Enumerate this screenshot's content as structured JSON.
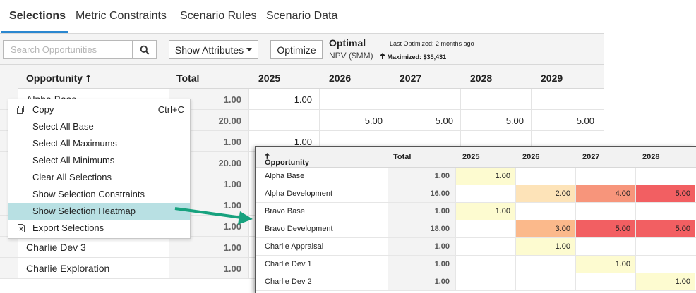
{
  "tabs": [
    "Selections",
    "Metric Constraints",
    "Scenario Rules",
    "Scenario Data"
  ],
  "toolbar": {
    "search_placeholder": "Search Opportunities",
    "show_attributes": "Show Attributes",
    "optimize": "Optimize",
    "status": "Optimal",
    "last_optimized_label": "Last Optimized:",
    "last_optimized_value": "2 months ago",
    "npv_label": "NPV ($MM)",
    "maximized_label": "Maximized:",
    "maximized_value": "$35,431"
  },
  "grid": {
    "headers": {
      "opportunity": "Opportunity",
      "total": "Total",
      "years": [
        "2025",
        "2026",
        "2027",
        "2028",
        "2029"
      ]
    },
    "rows": [
      {
        "name": "Alpha Base",
        "total": "1.00",
        "cells": [
          "1.00",
          "",
          "",
          "",
          ""
        ]
      },
      {
        "name": "",
        "total": "20.00",
        "cells": [
          "",
          "5.00",
          "5.00",
          "5.00",
          "5.00"
        ]
      },
      {
        "name": "",
        "total": "1.00",
        "cells": [
          "1.00",
          "",
          "",
          "",
          ""
        ]
      },
      {
        "name": "",
        "total": "20.00",
        "cells": [
          "",
          "",
          "",
          "",
          ""
        ]
      },
      {
        "name": "",
        "total": "1.00",
        "cells": [
          "",
          "",
          "",
          "",
          ""
        ]
      },
      {
        "name": "",
        "total": "1.00",
        "cells": [
          "",
          "",
          "",
          "",
          ""
        ]
      },
      {
        "name": "",
        "total": "1.00",
        "cells": [
          "",
          "",
          "",
          "",
          ""
        ]
      },
      {
        "name": "Charlie Dev 3",
        "total": "1.00",
        "cells": [
          "",
          "",
          "",
          "",
          ""
        ]
      },
      {
        "name": "Charlie Exploration",
        "total": "1.00",
        "cells": [
          "",
          "",
          "",
          "",
          ""
        ]
      }
    ]
  },
  "context_menu": {
    "items": [
      {
        "label": "Copy",
        "shortcut": "Ctrl+C",
        "icon": "copy-icon"
      },
      {
        "label": "Select All Base",
        "shortcut": ""
      },
      {
        "label": "Select All Maximums",
        "shortcut": ""
      },
      {
        "label": "Select All Minimums",
        "shortcut": ""
      },
      {
        "label": "Clear All Selections",
        "shortcut": ""
      },
      {
        "label": "Show Selection Constraints",
        "shortcut": ""
      },
      {
        "label": "Show Selection Heatmap",
        "shortcut": "",
        "highlighted": true
      },
      {
        "label": "Export Selections",
        "shortcut": "",
        "icon": "excel-icon"
      }
    ]
  },
  "heatmap": {
    "headers": {
      "opportunity": "Opportunity",
      "total": "Total",
      "years": [
        "2025",
        "2026",
        "2027",
        "2028"
      ]
    },
    "rows": [
      {
        "name": "Alpha Base",
        "total": "1.00",
        "cells": [
          "1.00",
          "",
          "",
          ""
        ]
      },
      {
        "name": "Alpha Development",
        "total": "16.00",
        "cells": [
          "",
          "2.00",
          "4.00",
          "5.00"
        ]
      },
      {
        "name": "Bravo Base",
        "total": "1.00",
        "cells": [
          "1.00",
          "",
          "",
          ""
        ]
      },
      {
        "name": "Bravo Development",
        "total": "18.00",
        "cells": [
          "",
          "3.00",
          "5.00",
          "5.00"
        ]
      },
      {
        "name": "Charlie Appraisal",
        "total": "1.00",
        "cells": [
          "",
          "1.00",
          "",
          ""
        ]
      },
      {
        "name": "Charlie Dev 1",
        "total": "1.00",
        "cells": [
          "",
          "",
          "1.00",
          ""
        ]
      },
      {
        "name": "Charlie Dev 2",
        "total": "1.00",
        "cells": [
          "",
          "",
          "",
          "1.00"
        ]
      }
    ],
    "colors": {
      "1": "#fdfbd0",
      "2": "#fde3b8",
      "3": "#fbb98b",
      "4": "#f7957b",
      "5": "#f25f62"
    }
  },
  "colors": {
    "accent": "#2a87d0",
    "highlight": "#b8e0e3",
    "arrow": "#17a27e"
  }
}
